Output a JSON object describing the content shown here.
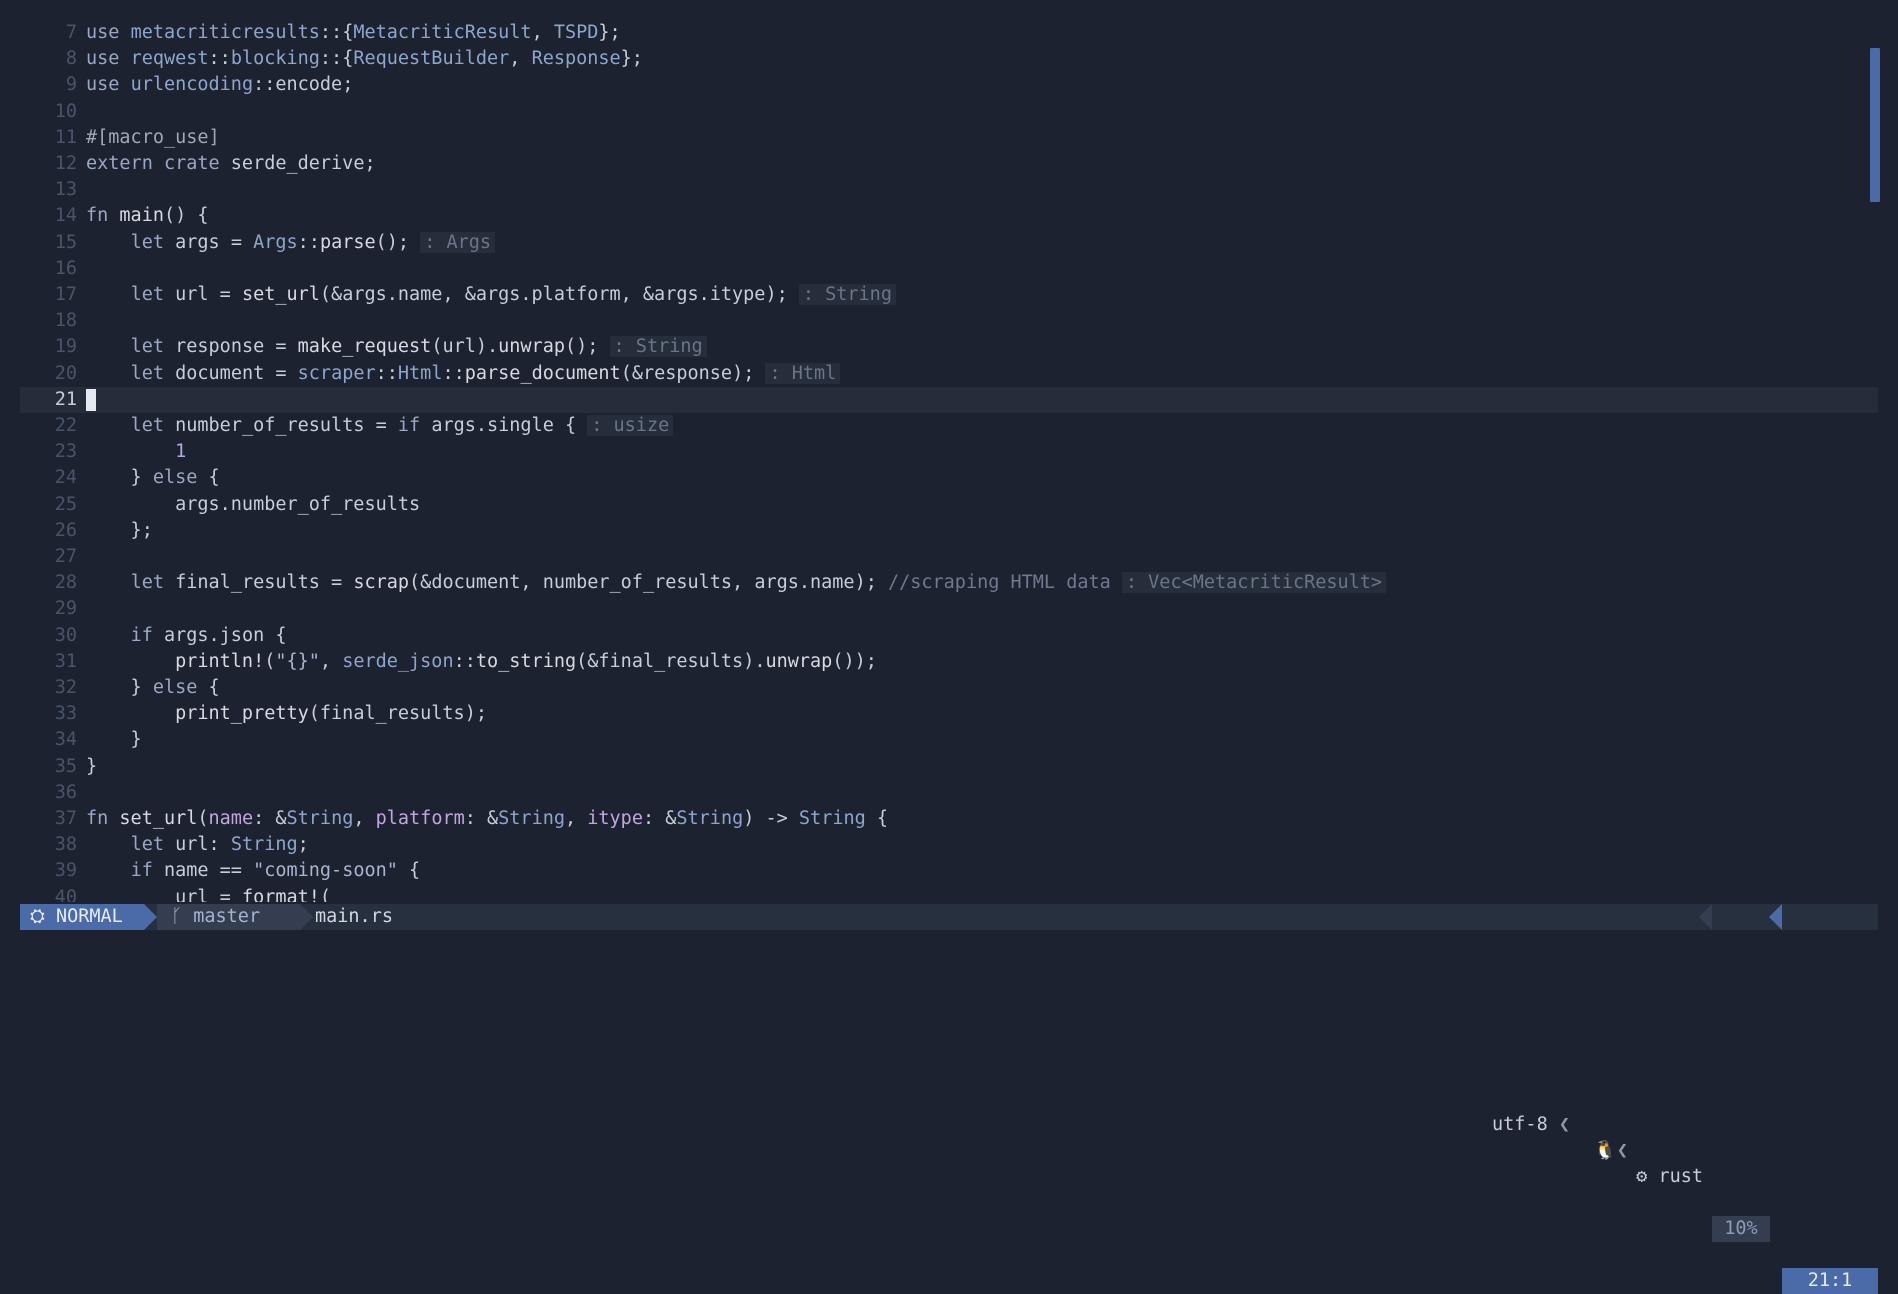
{
  "editor": {
    "current_line": 21,
    "lines": [
      {
        "n": "7",
        "tokens": [
          [
            "kw",
            "use "
          ],
          [
            "mod",
            "metacriticresults"
          ],
          [
            "plain",
            "::{"
          ],
          [
            "ty",
            "MetacriticResult"
          ],
          [
            "plain",
            ", "
          ],
          [
            "ty",
            "TSPD"
          ],
          [
            "plain",
            "};"
          ]
        ]
      },
      {
        "n": "8",
        "tokens": [
          [
            "kw",
            "use "
          ],
          [
            "mod",
            "reqwest"
          ],
          [
            "plain",
            "::"
          ],
          [
            "mod",
            "blocking"
          ],
          [
            "plain",
            "::{"
          ],
          [
            "ty",
            "RequestBuilder"
          ],
          [
            "plain",
            ", "
          ],
          [
            "ty",
            "Response"
          ],
          [
            "plain",
            "};"
          ]
        ]
      },
      {
        "n": "9",
        "tokens": [
          [
            "kw",
            "use "
          ],
          [
            "mod",
            "urlencoding"
          ],
          [
            "plain",
            "::encode;"
          ]
        ]
      },
      {
        "n": "10",
        "tokens": []
      },
      {
        "n": "11",
        "tokens": [
          [
            "attr",
            "#[macro_use]"
          ]
        ]
      },
      {
        "n": "12",
        "tokens": [
          [
            "kw",
            "extern crate "
          ],
          [
            "plain",
            "serde_derive;"
          ]
        ]
      },
      {
        "n": "13",
        "tokens": []
      },
      {
        "n": "14",
        "tokens": [
          [
            "kw",
            "fn "
          ],
          [
            "fn",
            "main"
          ],
          [
            "plain",
            "() {"
          ]
        ]
      },
      {
        "n": "15",
        "tokens": [
          [
            "plain",
            "    "
          ],
          [
            "kw",
            "let "
          ],
          [
            "plain",
            "args = "
          ],
          [
            "ty",
            "Args"
          ],
          [
            "plain",
            "::"
          ],
          [
            "fn",
            "parse"
          ],
          [
            "plain",
            "(); "
          ],
          [
            "hint",
            ": Args"
          ]
        ]
      },
      {
        "n": "16",
        "tokens": []
      },
      {
        "n": "17",
        "tokens": [
          [
            "plain",
            "    "
          ],
          [
            "kw",
            "let "
          ],
          [
            "plain",
            "url = "
          ],
          [
            "fn",
            "set_url"
          ],
          [
            "plain",
            "(&args.name, &args.platform, &args.itype); "
          ],
          [
            "hint",
            ": String"
          ]
        ]
      },
      {
        "n": "18",
        "tokens": []
      },
      {
        "n": "19",
        "tokens": [
          [
            "plain",
            "    "
          ],
          [
            "kw",
            "let "
          ],
          [
            "plain",
            "response = "
          ],
          [
            "fn",
            "make_request"
          ],
          [
            "plain",
            "(url)."
          ],
          [
            "fn",
            "unwrap"
          ],
          [
            "plain",
            "(); "
          ],
          [
            "hint",
            ": String"
          ]
        ]
      },
      {
        "n": "20",
        "tokens": [
          [
            "plain",
            "    "
          ],
          [
            "kw",
            "let "
          ],
          [
            "plain",
            "document = "
          ],
          [
            "mod",
            "scraper"
          ],
          [
            "plain",
            "::"
          ],
          [
            "ty",
            "Html"
          ],
          [
            "plain",
            "::"
          ],
          [
            "fn",
            "parse_document"
          ],
          [
            "plain",
            "(&response); "
          ],
          [
            "hint",
            ": Html"
          ]
        ]
      },
      {
        "n": "21",
        "tokens": []
      },
      {
        "n": "22",
        "tokens": [
          [
            "plain",
            "    "
          ],
          [
            "kw",
            "let "
          ],
          [
            "plain",
            "number_of_results = "
          ],
          [
            "kw",
            "if "
          ],
          [
            "plain",
            "args.single { "
          ],
          [
            "hint",
            ": usize"
          ]
        ]
      },
      {
        "n": "23",
        "tokens": [
          [
            "plain",
            "        "
          ],
          [
            "num",
            "1"
          ]
        ]
      },
      {
        "n": "24",
        "tokens": [
          [
            "plain",
            "    } "
          ],
          [
            "kw",
            "else "
          ],
          [
            "plain",
            "{"
          ]
        ]
      },
      {
        "n": "25",
        "tokens": [
          [
            "plain",
            "        args.number_of_results"
          ]
        ]
      },
      {
        "n": "26",
        "tokens": [
          [
            "plain",
            "    };"
          ]
        ]
      },
      {
        "n": "27",
        "tokens": []
      },
      {
        "n": "28",
        "tokens": [
          [
            "plain",
            "    "
          ],
          [
            "kw",
            "let "
          ],
          [
            "plain",
            "final_results = "
          ],
          [
            "fn",
            "scrap"
          ],
          [
            "plain",
            "(&document, number_of_results, args.name); "
          ],
          [
            "cmt",
            "//scraping HTML data "
          ],
          [
            "hint",
            ": Vec<MetacriticResult>"
          ]
        ]
      },
      {
        "n": "29",
        "tokens": []
      },
      {
        "n": "30",
        "tokens": [
          [
            "plain",
            "    "
          ],
          [
            "kw",
            "if "
          ],
          [
            "plain",
            "args.json {"
          ]
        ]
      },
      {
        "n": "31",
        "tokens": [
          [
            "plain",
            "        "
          ],
          [
            "fn",
            "println!"
          ],
          [
            "plain",
            "("
          ],
          [
            "str",
            "\"{}\""
          ],
          [
            "plain",
            ", "
          ],
          [
            "mod",
            "serde_json"
          ],
          [
            "plain",
            "::"
          ],
          [
            "fn",
            "to_string"
          ],
          [
            "plain",
            "(&final_results)."
          ],
          [
            "fn",
            "unwrap"
          ],
          [
            "plain",
            "());"
          ]
        ]
      },
      {
        "n": "32",
        "tokens": [
          [
            "plain",
            "    } "
          ],
          [
            "kw",
            "else "
          ],
          [
            "plain",
            "{"
          ]
        ]
      },
      {
        "n": "33",
        "tokens": [
          [
            "plain",
            "        "
          ],
          [
            "fn",
            "print_pretty"
          ],
          [
            "plain",
            "(final_results);"
          ]
        ]
      },
      {
        "n": "34",
        "tokens": [
          [
            "plain",
            "    }"
          ]
        ]
      },
      {
        "n": "35",
        "tokens": [
          [
            "plain",
            "}"
          ]
        ]
      },
      {
        "n": "36",
        "tokens": []
      },
      {
        "n": "37",
        "tokens": [
          [
            "kw",
            "fn "
          ],
          [
            "fn",
            "set_url"
          ],
          [
            "plain",
            "("
          ],
          [
            "par",
            "name"
          ],
          [
            "plain",
            ": &"
          ],
          [
            "ty",
            "String"
          ],
          [
            "plain",
            ", "
          ],
          [
            "par",
            "platform"
          ],
          [
            "plain",
            ": &"
          ],
          [
            "ty",
            "String"
          ],
          [
            "plain",
            ", "
          ],
          [
            "par",
            "itype"
          ],
          [
            "plain",
            ": &"
          ],
          [
            "ty",
            "String"
          ],
          [
            "plain",
            ") -> "
          ],
          [
            "ty",
            "String"
          ],
          [
            "plain",
            " {"
          ]
        ]
      },
      {
        "n": "38",
        "tokens": [
          [
            "plain",
            "    "
          ],
          [
            "kw",
            "let "
          ],
          [
            "plain",
            "url: "
          ],
          [
            "ty",
            "String"
          ],
          [
            "plain",
            ";"
          ]
        ]
      },
      {
        "n": "39",
        "tokens": [
          [
            "plain",
            "    "
          ],
          [
            "kw",
            "if "
          ],
          [
            "plain",
            "name == "
          ],
          [
            "str",
            "\"coming-soon\""
          ],
          [
            "plain",
            " {"
          ]
        ]
      },
      {
        "n": "40",
        "tokens": [
          [
            "plain",
            "        url = "
          ],
          [
            "fn",
            "format!"
          ],
          [
            "plain",
            "("
          ]
        ]
      }
    ]
  },
  "statusline": {
    "mode_icon": "⛭",
    "mode": "NORMAL",
    "branch_icon": "ᚴ",
    "branch": "master",
    "file": "main.rs",
    "encoding": "utf-8",
    "os_icon": "🐧",
    "filetype_icon": "⚙",
    "filetype": "rust",
    "percent": "10%",
    "position": "21:1",
    "separator_left": "❮"
  },
  "colors": {
    "background": "#1c2230",
    "accent": "#4b6aa8",
    "current_line": "#252c3a"
  }
}
